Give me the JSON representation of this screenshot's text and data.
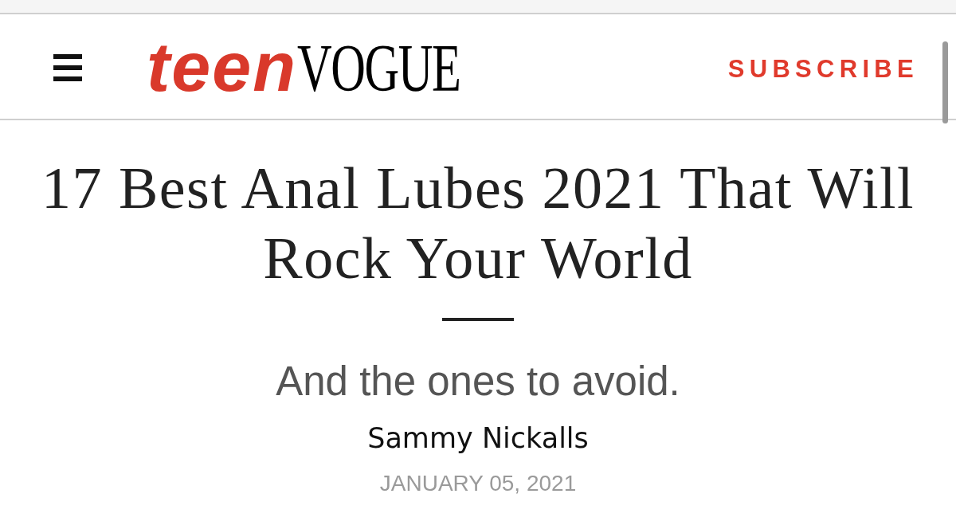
{
  "header": {
    "logo": {
      "first": "teen",
      "second": "VOGUE"
    },
    "subscribe": "SUBSCRIBE"
  },
  "article": {
    "title": "17 Best Anal Lubes 2021 That Will Rock Your World",
    "dek": "And the ones to avoid.",
    "author": "Sammy Nickalls",
    "date": "JANUARY 05, 2021"
  }
}
